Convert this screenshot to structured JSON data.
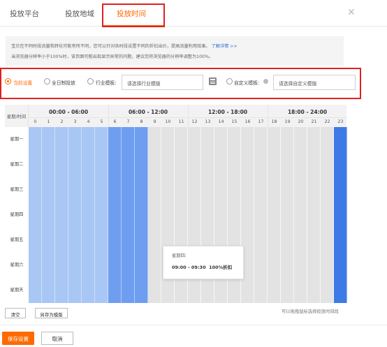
{
  "tabs": [
    {
      "label": "投放平台",
      "active": false
    },
    {
      "label": "投放地域",
      "active": false
    },
    {
      "label": "投放时间",
      "active": true
    }
  ],
  "close_icon": "close-icon",
  "notice": {
    "line1": "宝贝在不同时段流量和转化可能有所不同，您可以针对各时段设置不同的折扣出价，提高流量利用效果。",
    "link": "了解详情 >>",
    "line2": "当浏览器分辨率小于100%时，该页面可能出现显示异常的问题，建议您将浏览器的分辨率调整为100%。"
  },
  "options": {
    "current": "当前设置",
    "fullday": "全日制投放",
    "industry": "行业模板:",
    "industry_placeholder": "请选择行业模版",
    "custom": "自定义模板:",
    "custom_placeholder": "请选择自定义模版"
  },
  "grid": {
    "corner": "星期/时间",
    "periods": [
      "00:00 - 06:00",
      "06:00 - 12:00",
      "12:00 - 18:00",
      "18:00 - 24:00"
    ],
    "hours": [
      "0",
      "1",
      "2",
      "3",
      "4",
      "5",
      "6",
      "7",
      "8",
      "9",
      "10",
      "11",
      "12",
      "13",
      "14",
      "15",
      "16",
      "17",
      "18",
      "19",
      "20",
      "21",
      "22",
      "23"
    ],
    "days": [
      "星期一",
      "星期二",
      "星期三",
      "星期四",
      "星期五",
      "星期六",
      "星期天"
    ],
    "hour_states": [
      "light",
      "light",
      "light",
      "light",
      "light",
      "light",
      "mid",
      "mid",
      "mid",
      "empty",
      "empty",
      "empty",
      "empty",
      "empty",
      "empty",
      "empty",
      "empty",
      "empty",
      "empty",
      "empty",
      "empty",
      "empty",
      "empty",
      "dark"
    ],
    "colors": {
      "light": "#a9c7f5",
      "mid": "#6f9ef0",
      "dark": "#3d7ae5",
      "empty": "#e3e3e3"
    }
  },
  "tooltip": {
    "day": "星期四:",
    "time": "09:00 - 09:30",
    "discount": "100%折扣"
  },
  "bottom": {
    "clear": "清空",
    "save_template": "另存为模版",
    "hint": "可以拖拽鼠标选择投放时间段",
    "save": "保存设置",
    "cancel": "取消"
  },
  "accent_color": "#ff6a00"
}
